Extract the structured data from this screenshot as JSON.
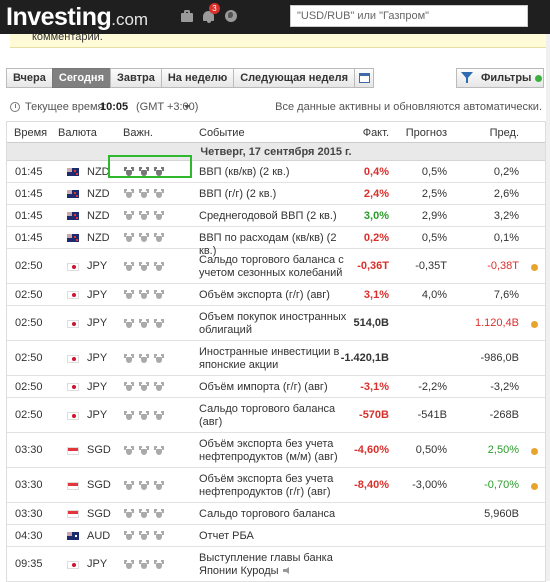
{
  "header": {
    "logo_main": "Investing",
    "logo_suffix": ".com",
    "notification_count": "3",
    "search_placeholder": "\"USD/RUB\" или \"Газпром\""
  },
  "notice": {
    "text": "комментарии."
  },
  "tabs": [
    "Вчера",
    "Сегодня",
    "Завтра",
    "На неделю",
    "Следующая неделя"
  ],
  "active_tab": "Сегодня",
  "filter_label": "Фильтры",
  "time_bar": {
    "label": "Текущее время:",
    "time": "10:05",
    "tz": "(GMT +3:00)",
    "status": "Все данные активны и обновляются автоматически."
  },
  "columns": {
    "time": "Время",
    "currency": "Валюта",
    "importance": "Важн.",
    "event": "Событие",
    "actual": "Факт.",
    "forecast": "Прогноз",
    "previous": "Пред."
  },
  "date_header": "Четверг, 17 сентября 2015 г.",
  "rows": [
    {
      "time": "01:45",
      "flag": "nz",
      "currency": "NZD",
      "imp": 3,
      "event": "ВВП (кв/кв) (2 кв.)",
      "actual": "0,4%",
      "actual_color": "red",
      "forecast": "0,5%",
      "previous": "0,2%",
      "prev_color": "",
      "rev": false
    },
    {
      "time": "01:45",
      "flag": "nz",
      "currency": "NZD",
      "imp": 0,
      "event": "ВВП (г/г) (2 кв.)",
      "actual": "2,4%",
      "actual_color": "red",
      "forecast": "2,5%",
      "previous": "2,6%",
      "prev_color": "",
      "rev": false
    },
    {
      "time": "01:45",
      "flag": "nz",
      "currency": "NZD",
      "imp": 0,
      "event": "Среднегодовой ВВП (2 кв.)",
      "actual": "3,0%",
      "actual_color": "green",
      "forecast": "2,9%",
      "previous": "3,2%",
      "prev_color": "",
      "rev": false
    },
    {
      "time": "01:45",
      "flag": "nz",
      "currency": "NZD",
      "imp": 0,
      "event": "ВВП по расходам (кв/кв) (2 кв.)",
      "actual": "0,2%",
      "actual_color": "red",
      "forecast": "0,5%",
      "previous": "0,1%",
      "prev_color": "",
      "rev": false
    },
    {
      "time": "02:50",
      "flag": "jp",
      "currency": "JPY",
      "imp": 0,
      "event": "Сальдо торгового баланса с учетом сезонных колебаний",
      "actual": "-0,36T",
      "actual_color": "red",
      "forecast": "-0,35T",
      "previous": "-0,38T",
      "prev_color": "red",
      "rev": true
    },
    {
      "time": "02:50",
      "flag": "jp",
      "currency": "JPY",
      "imp": 0,
      "event": "Объём экспорта (г/г) (авг)",
      "actual": "3,1%",
      "actual_color": "red",
      "forecast": "4,0%",
      "previous": "7,6%",
      "prev_color": "",
      "rev": false
    },
    {
      "time": "02:50",
      "flag": "jp",
      "currency": "JPY",
      "imp": 0,
      "event": "Объем покупок иностранных облигаций",
      "actual": "514,0B",
      "actual_color": "",
      "forecast": "",
      "previous": "1.120,4B",
      "prev_color": "red",
      "rev": true
    },
    {
      "time": "02:50",
      "flag": "jp",
      "currency": "JPY",
      "imp": 0,
      "event": "Иностранные инвестиции в японские акции",
      "actual": "-1.420,1B",
      "actual_color": "",
      "forecast": "",
      "previous": "-986,0B",
      "prev_color": "",
      "rev": false
    },
    {
      "time": "02:50",
      "flag": "jp",
      "currency": "JPY",
      "imp": 0,
      "event": "Объём импорта (г/г) (авг)",
      "actual": "-3,1%",
      "actual_color": "red",
      "forecast": "-2,2%",
      "previous": "-3,2%",
      "prev_color": "",
      "rev": false
    },
    {
      "time": "02:50",
      "flag": "jp",
      "currency": "JPY",
      "imp": 0,
      "event": "Сальдо торгового баланса (авг)",
      "actual": "-570B",
      "actual_color": "red",
      "forecast": "-541B",
      "previous": "-268B",
      "prev_color": "",
      "rev": false
    },
    {
      "time": "03:30",
      "flag": "sg",
      "currency": "SGD",
      "imp": 0,
      "event": "Объём экспорта без учета нефтепродуктов (м/м) (авг)",
      "actual": "-4,60%",
      "actual_color": "red",
      "forecast": "0,50%",
      "previous": "2,50%",
      "prev_color": "green",
      "rev": true
    },
    {
      "time": "03:30",
      "flag": "sg",
      "currency": "SGD",
      "imp": 0,
      "event": "Объём экспорта без учета нефтепродуктов (г/г) (авг)",
      "actual": "-8,40%",
      "actual_color": "red",
      "forecast": "-3,00%",
      "previous": "-0,70%",
      "prev_color": "green",
      "rev": true
    },
    {
      "time": "03:30",
      "flag": "sg",
      "currency": "SGD",
      "imp": 0,
      "event": "Сальдо торгового баланса",
      "actual": "",
      "actual_color": "",
      "forecast": "",
      "previous": "5,960B",
      "prev_color": "",
      "rev": false
    },
    {
      "time": "04:30",
      "flag": "au",
      "currency": "AUD",
      "imp": 0,
      "event": "Отчет РБА",
      "actual": "",
      "actual_color": "",
      "forecast": "",
      "previous": "",
      "prev_color": "",
      "rev": false
    },
    {
      "time": "09:35",
      "flag": "jp",
      "currency": "JPY",
      "imp": 0,
      "event": "Выступление главы банка Японии Куроды",
      "actual": "",
      "actual_color": "",
      "forecast": "",
      "previous": "",
      "prev_color": "",
      "rev": false,
      "speech": true
    }
  ]
}
